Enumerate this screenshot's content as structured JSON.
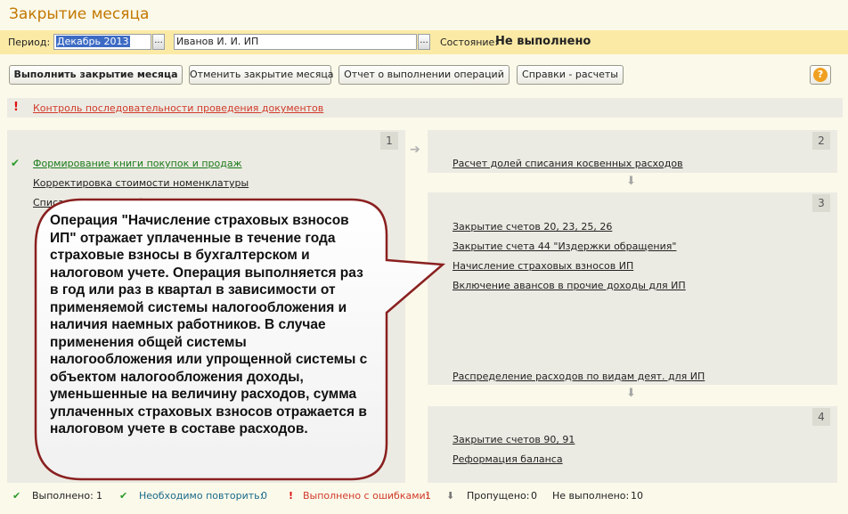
{
  "window": {
    "title": "Закрытие месяца"
  },
  "period_bar": {
    "period_label": "Период:",
    "period_value": "Декабрь 2013",
    "org_value": "Иванов И. И. ИП",
    "dots": "...",
    "state_label": "Состояние:",
    "state_value": "Не выполнено"
  },
  "toolbar": {
    "run": "Выполнить закрытие месяца",
    "cancel": "Отменить закрытие месяца",
    "report": "Отчет о выполнении операций",
    "help_calc": "Справки - расчеты",
    "help": "?"
  },
  "warning": {
    "mark": "!",
    "link": "Контроль последовательности проведения документов"
  },
  "steps": [
    {
      "number": "1",
      "items": [
        "Формирование книги покупок и продаж",
        "Корректировка стоимости номенклатуры",
        "Списание расходов будущих периодов"
      ]
    },
    {
      "number": "2",
      "items": [
        "Расчет долей списания косвенных расходов"
      ]
    },
    {
      "number": "3",
      "items": [
        "Закрытие счетов 20, 23, 25, 26",
        "Закрытие счета 44 \"Издержки обращения\"",
        "Начисление страховых взносов ИП",
        "Включение авансов в прочие доходы для ИП",
        "Распределение расходов по видам деят. для ИП"
      ]
    },
    {
      "number": "4",
      "items": [
        "Закрытие счетов 90, 91",
        "Реформация баланса"
      ]
    }
  ],
  "callout": {
    "text": "Операция \"Начисление страховых взносов ИП\" отражает уплаченные в течение года страховые взносы в бухгалтерском и налоговом учете. Операция выполняется раз в год или раз в квартал в зависимости от применяемой системы налогообложения и наличия наемных работников. В случае применения общей системы налогообложения или упрощенной системы с объектом налогообложения доходы, уменьшенные на величину расходов, сумма уплаченных страховых взносов отражается в налоговом учете в составе расходов."
  },
  "status": {
    "done_label": "Выполнено:",
    "done_count": "1",
    "repeat_label": "Необходимо повторить:",
    "repeat_count": "0",
    "errors_label": "Выполнено с ошибками:",
    "errors_count": "1",
    "skipped_label": "Пропущено:",
    "skipped_count": "0",
    "notdone_label": "Не выполнено:",
    "notdone_count": "10"
  },
  "colors": {
    "title": "#c27800",
    "period_bar": "#fbeaa6",
    "panel": "#ecebe3",
    "warning": "#d03a2a",
    "ok": "#2a9a2a"
  }
}
